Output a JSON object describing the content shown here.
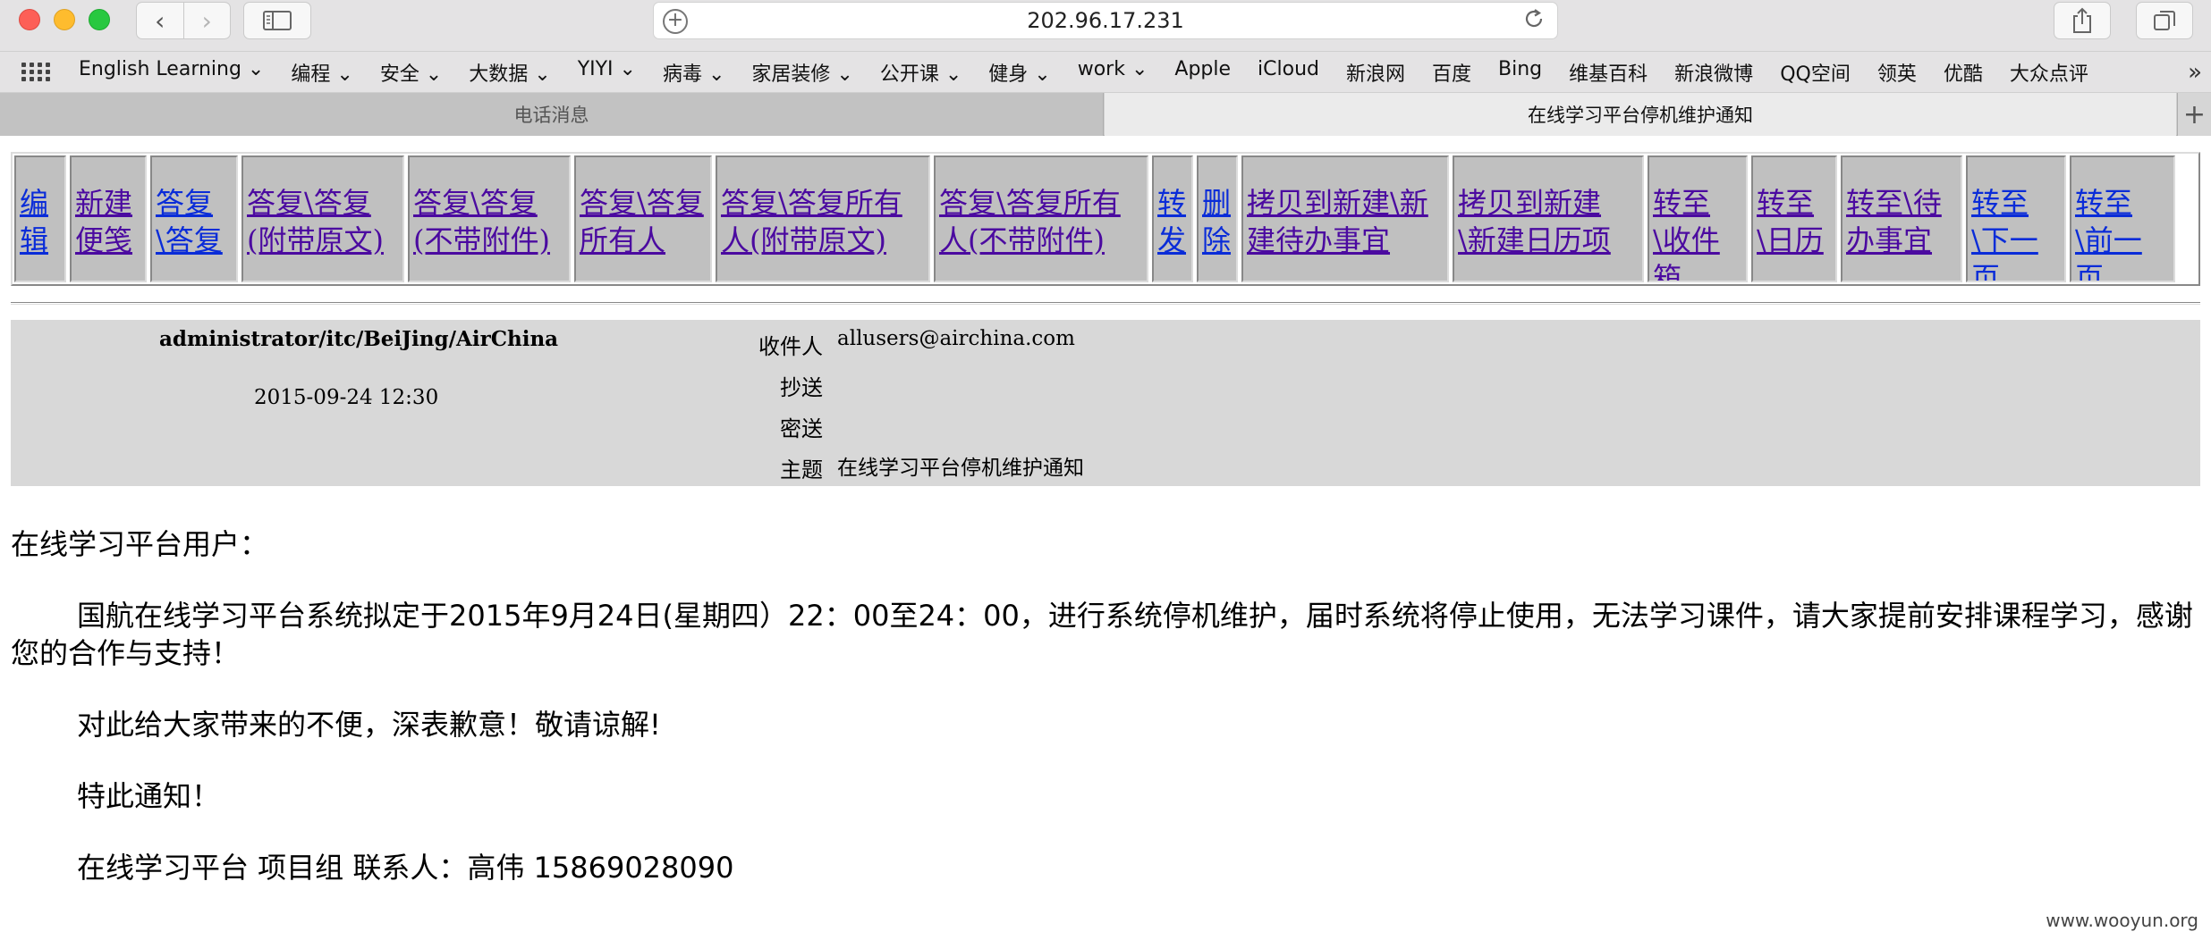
{
  "browser": {
    "url": "202.96.17.231",
    "back_glyph": "‹",
    "forward_glyph": "›",
    "bookmarks": [
      "English Learning ⌄",
      "编程 ⌄",
      "安全 ⌄",
      "大数据 ⌄",
      "YIYI ⌄",
      "病毒 ⌄",
      "家居装修 ⌄",
      "公开课 ⌄",
      "健身 ⌄",
      "work ⌄",
      "Apple",
      "iCloud",
      "新浪网",
      "百度",
      "Bing",
      "维基百科",
      "新浪微博",
      "QQ空间",
      "领英",
      "优酷",
      "大众点评"
    ],
    "bookmarks_more": "»",
    "tabs": [
      "电话消息",
      "在线学习平台停机维护通知"
    ],
    "new_tab": "+"
  },
  "toolbar": {
    "actions": [
      {
        "label": "编辑",
        "width": 58
      },
      {
        "label": "新建便笺",
        "width": 86
      },
      {
        "label": "答复\\答复",
        "width": 98
      },
      {
        "label": "答复\\答复(附带原文)",
        "width": 182
      },
      {
        "label": "答复\\答复(不带附件)",
        "width": 182
      },
      {
        "label": "答复\\答复所有人",
        "width": 154
      },
      {
        "label": "答复\\答复所有人(附带原文)",
        "width": 240
      },
      {
        "label": "答复\\答复所有人(不带附件)",
        "width": 240
      },
      {
        "label": "转发",
        "width": 46
      },
      {
        "label": "删除",
        "width": 46
      },
      {
        "label": "拷贝到新建\\新建待办事宜",
        "width": 232
      },
      {
        "label": "拷贝到新建\\新建日历项",
        "width": 214
      },
      {
        "label": "转至\\收件箱",
        "width": 112
      },
      {
        "label": "转至\\日历",
        "width": 96
      },
      {
        "label": "转至\\待办事宜",
        "width": 136
      },
      {
        "label": "转至\\下一页",
        "width": 112
      },
      {
        "label": "转至\\前一页",
        "width": 118
      }
    ]
  },
  "email": {
    "from": "administrator/itc/BeiJing/AirChina",
    "date": "2015-09-24 12:30",
    "to_label": "收件人",
    "to": "allusers@airchina.com",
    "cc_label": "抄送",
    "bcc_label": "密送",
    "subject_label": "主题",
    "subject": "在线学习平台停机维护通知",
    "greeting": "在线学习平台用户：",
    "para1": "国航在线学习平台系统拟定于2015年9月24日(星期四）22：00至24：00，进行系统停机维护，届时系统将停止使用，无法学习课件，请大家提前安排课程学习，感谢您的合作与支持！",
    "para2": "对此给大家带来的不便，深表歉意！敬请谅解!",
    "para3": "特此通知！",
    "signature": "在线学习平台  项目组 联系人：高伟 15869028090"
  },
  "watermark": "www.wooyun.org"
}
